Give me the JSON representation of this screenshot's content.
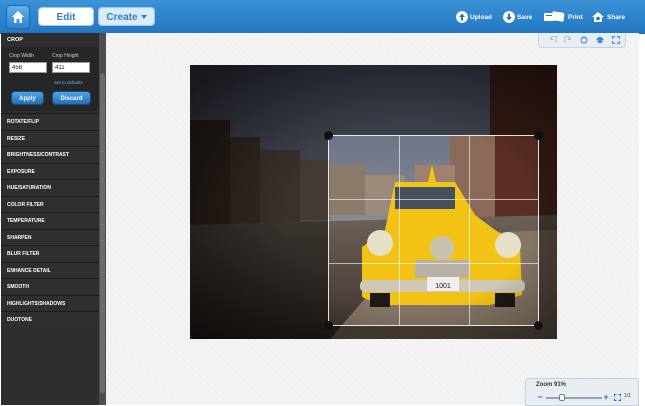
{
  "header": {
    "tabs": [
      {
        "label": "Edit"
      },
      {
        "label": "Create"
      }
    ],
    "actions": [
      {
        "label": "Upload",
        "icon": "upload-icon"
      },
      {
        "label": "Save",
        "icon": "save-icon"
      },
      {
        "label": "Print",
        "icon": "print-icon"
      },
      {
        "label": "Share",
        "icon": "share-icon"
      }
    ]
  },
  "sidebar": {
    "crop": {
      "title": "CROP",
      "width_label": "Crop Width",
      "height_label": "Crop Height",
      "width_value": "458",
      "height_value": "411",
      "defaults_link": "Set to defaults",
      "apply_label": "Apply",
      "discard_label": "Discard"
    },
    "items": [
      {
        "label": "ROTATE/FLIP"
      },
      {
        "label": "RESIZE"
      },
      {
        "label": "BRIGHTNESS/CONTRAST"
      },
      {
        "label": "EXPOSURE"
      },
      {
        "label": "HUE/SATURATION"
      },
      {
        "label": "COLOR FILTER"
      },
      {
        "label": "TEMPERATURE"
      },
      {
        "label": "SHARPEN"
      },
      {
        "label": "BLUR FILTER"
      },
      {
        "label": "ENHANCE DETAIL"
      },
      {
        "label": "SMOOTH"
      },
      {
        "label": "HIGHLIGHTS/SHADOWS"
      },
      {
        "label": "DUOTONE"
      }
    ]
  },
  "zoom": {
    "label": "Zoom 91%",
    "level": 0.91,
    "page": "1/1"
  },
  "photo": {
    "plate": "1001"
  },
  "colors": {
    "accent": "#2b7fc8",
    "sidebar": "#2e2e2e",
    "taxi": "#f2c314"
  }
}
